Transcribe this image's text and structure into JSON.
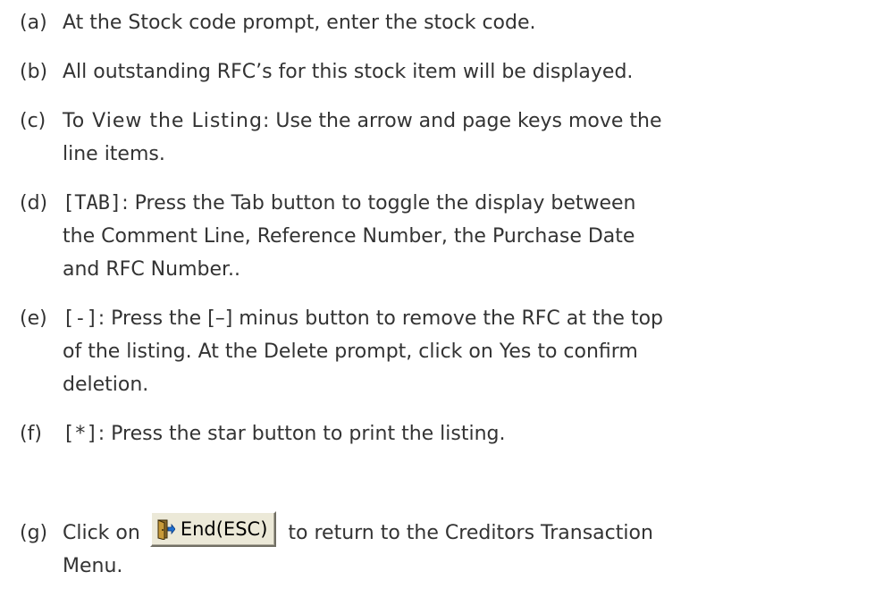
{
  "steps": [
    {
      "marker": "(a)",
      "lines": [
        "At the Stock code prompt, enter the stock code."
      ]
    },
    {
      "marker": "(b)",
      "lines": [
        "All outstanding RFC’s for this stock item will be displayed."
      ]
    },
    {
      "marker": "(c)",
      "lead": "To View the Listing",
      "lines_rest": [
        ": Use the arrow and page keys move the",
        "line items."
      ]
    },
    {
      "marker": "(d)",
      "key": "[TAB]",
      "lines_rest": [
        ": Press the Tab button to toggle the display between",
        "the Comment Line, Reference Number, the Purchase Date",
        "and RFC Number.."
      ]
    },
    {
      "marker": "(e)",
      "key": "[-]",
      "lines_rest": [
        ": Press the [–] minus button to remove the RFC at the top",
        "of the listing. At the Delete prompt, click on Yes to confirm",
        "deletion."
      ]
    },
    {
      "marker": "(f)",
      "key": "[*]",
      "lines_rest": [
        ": Press the star button to print the listing."
      ]
    },
    {
      "marker": "(g)",
      "before": "Click on",
      "button_label": "End(ESC)",
      "button_icon": "exit-door-icon",
      "after": "to return to the Creditors Transaction",
      "line2": "Menu."
    }
  ]
}
